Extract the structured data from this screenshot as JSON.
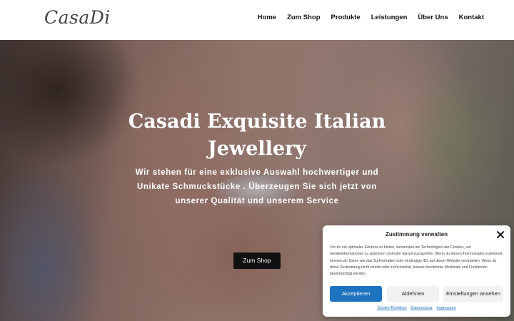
{
  "header": {
    "logo": "CasaDi",
    "nav": [
      {
        "label": "Home"
      },
      {
        "label": "Zum Shop"
      },
      {
        "label": "Produkte"
      },
      {
        "label": "Leistungen"
      },
      {
        "label": "Über Uns"
      },
      {
        "label": "Kontakt"
      }
    ]
  },
  "hero": {
    "title": "Casadi Exquisite Italian Jewellery",
    "subtitle": "Wir stehen für eine exklusive Auswahl hochwertiger und Unikate Schmuckstücke . Überzeugen Sie sich jetzt von unserer Qualität und unserem Service",
    "cta_label": "Zum Shop"
  },
  "consent": {
    "title": "Zustimmung verwalten",
    "body": "Um dir ein optimales Erlebnis zu bieten, verwenden wir Technologien wie Cookies, um Geräteinformationen zu speichern und/oder darauf zuzugreifen. Wenn du diesen Technologien zustimmst, können wir Daten wie das Surfverhalten oder eindeutige IDs auf dieser Website verarbeiten. Wenn du deine Zustimmung nicht erteilst oder zurückziehst, können bestimmte Merkmale und Funktionen beeinträchtigt werden.",
    "accept_label": "Akzeptieren",
    "reject_label": "Ablehnen",
    "settings_label": "Einstellungen ansehen",
    "links": [
      "Cookie-Richtlinie",
      "Datenschutz",
      "Impressum"
    ]
  },
  "colors": {
    "accent": "#1e73be",
    "cta_background": "#111111"
  }
}
